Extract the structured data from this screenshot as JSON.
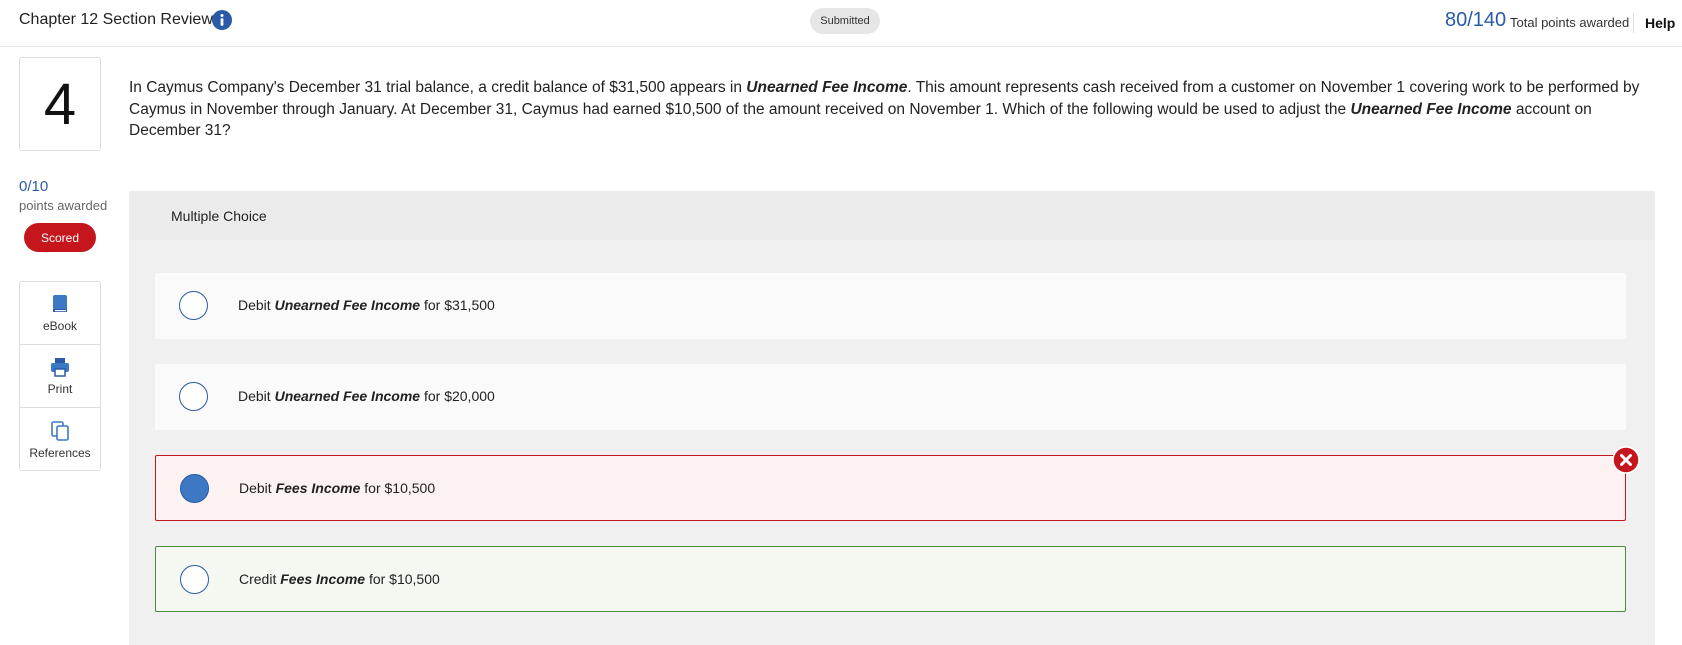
{
  "header": {
    "title": "Chapter 12 Section Review",
    "status": "Submitted",
    "score": "80/140",
    "score_label": "Total points awarded",
    "help": "Help"
  },
  "question": {
    "number": "4",
    "points": "0/10",
    "points_label": "points awarded",
    "badge": "Scored",
    "text_parts": [
      "In Caymus Company's December 31 trial balance, a credit balance of $31,500 appears in ",
      "Unearned Fee Income",
      ". This amount represents cash received from a customer on November 1 covering work to be performed by Caymus in November through January. At December 31, Caymus had earned $10,500 of the amount received on November 1. Which of the following would be used to adjust the ",
      "Unearned Fee Income",
      " account on December 31?"
    ]
  },
  "tools": [
    {
      "label": "eBook",
      "icon": "book-icon"
    },
    {
      "label": "Print",
      "icon": "printer-icon"
    },
    {
      "label": "References",
      "icon": "copy-icon"
    }
  ],
  "choice_panel": {
    "title": "Multiple Choice",
    "options": [
      {
        "prefix": "Debit ",
        "account": "Unearned Fee Income",
        "suffix": " for $31,500",
        "state": "default"
      },
      {
        "prefix": "Debit ",
        "account": "Unearned Fee Income",
        "suffix": " for $20,000",
        "state": "default"
      },
      {
        "prefix": "Debit ",
        "account": "Fees Income",
        "suffix": " for $10,500",
        "state": "selected-wrong"
      },
      {
        "prefix": "Credit ",
        "account": "Fees Income",
        "suffix": " for $10,500",
        "state": "correct"
      }
    ]
  },
  "colors": {
    "accent": "#2a5aa8",
    "error": "#c5161d",
    "success": "#4a8a3c"
  }
}
